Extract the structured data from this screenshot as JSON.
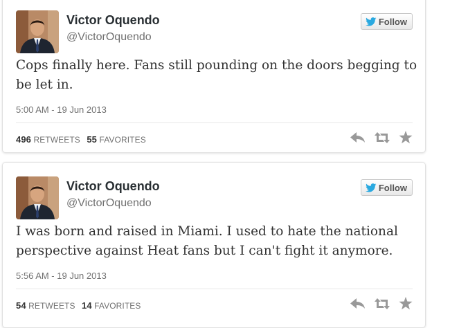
{
  "tweets": [
    {
      "name": "Victor Oquendo",
      "handle": "@VictorOquendo",
      "follow_label": "Follow",
      "text": "Cops finally here. Fans still pounding on the doors begging to be let in.",
      "timestamp": "5:00 AM - 19 Jun 2013",
      "retweets_count": "496",
      "retweets_label": "RETWEETS",
      "favorites_count": "55",
      "favorites_label": "FAVORITES"
    },
    {
      "name": "Victor Oquendo",
      "handle": "@VictorOquendo",
      "follow_label": "Follow",
      "text": "I was born and raised in Miami. I used to hate the national perspective against Heat fans but I can't fight it anymore.",
      "timestamp": "5:56 AM - 19 Jun 2013",
      "retweets_count": "54",
      "retweets_label": "RETWEETS",
      "favorites_count": "14",
      "favorites_label": "FAVORITES"
    }
  ],
  "icons": {
    "follow": "twitter-bird-icon",
    "reply": "reply-icon",
    "retweet": "retweet-icon",
    "favorite": "star-icon"
  },
  "colors": {
    "twitter_blue": "#2aa9e0",
    "action_icon": "#999999",
    "name_text": "#292f33",
    "meta_text": "#707070"
  }
}
